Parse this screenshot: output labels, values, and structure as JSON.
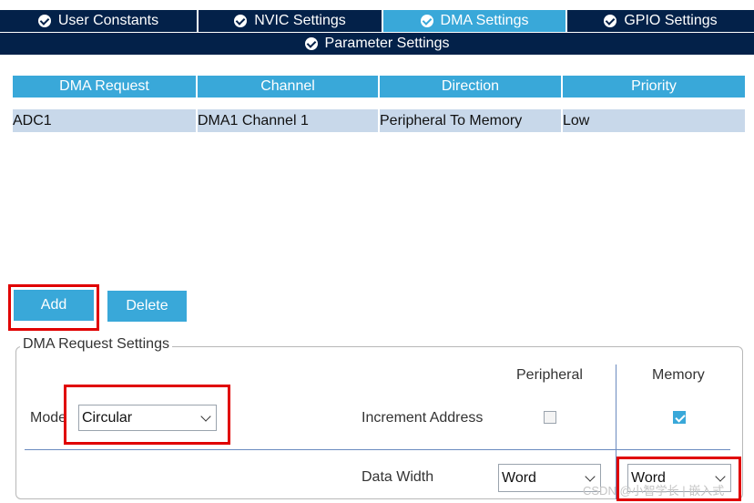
{
  "tabs": [
    {
      "label": "User Constants"
    },
    {
      "label": "NVIC Settings"
    },
    {
      "label": "DMA Settings"
    },
    {
      "label": "GPIO Settings"
    }
  ],
  "subtab": {
    "label": "Parameter Settings"
  },
  "table": {
    "headers": [
      "DMA Request",
      "Channel",
      "Direction",
      "Priority"
    ],
    "rows": [
      {
        "request": "ADC1",
        "channel": "DMA1 Channel 1",
        "direction": "Peripheral To Memory",
        "priority": "Low"
      }
    ]
  },
  "buttons": {
    "add": "Add",
    "delete": "Delete"
  },
  "settings": {
    "legend": "DMA Request Settings",
    "peripheral_header": "Peripheral",
    "memory_header": "Memory",
    "mode_label": "Mode",
    "mode_value": "Circular",
    "increment_label": "Increment Address",
    "peripheral_increment": false,
    "memory_increment": true,
    "data_width_label": "Data Width",
    "peripheral_width": "Word",
    "memory_width": "Word"
  },
  "watermark": "CSDN @小智学长 | 嵌入式",
  "colors": {
    "navy": "#032149",
    "accent": "#39a8d9",
    "row": "#c8d8ea",
    "highlight": "#e00000"
  }
}
